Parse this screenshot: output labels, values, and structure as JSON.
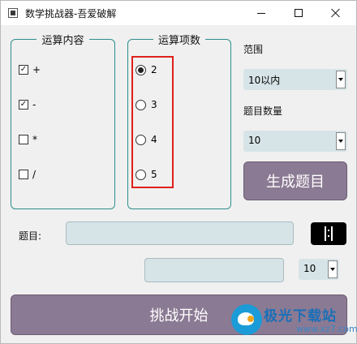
{
  "window": {
    "title": "数学挑战器-吾爱破解"
  },
  "content_group": {
    "title": "运算内容",
    "items": [
      {
        "label": "+",
        "checked": true
      },
      {
        "label": "-",
        "checked": true
      },
      {
        "label": "*",
        "checked": false
      },
      {
        "label": "/",
        "checked": false
      }
    ]
  },
  "operands_group": {
    "title": "运算项数",
    "items": [
      {
        "label": "2",
        "selected": true
      },
      {
        "label": "3",
        "selected": false
      },
      {
        "label": "4",
        "selected": false
      },
      {
        "label": "5",
        "selected": false
      }
    ]
  },
  "range": {
    "label": "范围",
    "value": "10以内"
  },
  "count": {
    "label": "题目数量",
    "value": "10"
  },
  "generate_button": "生成题目",
  "question": {
    "label": "题目:",
    "value": ""
  },
  "answer": {
    "value": ""
  },
  "timer_select": {
    "value": "10"
  },
  "start_button": "挑战开始",
  "watermark": {
    "text": "极光下载站",
    "url": "www.xz7.com"
  },
  "colors": {
    "accent": "#8b7a93",
    "group_border": "#2f8d8d",
    "highlight": "#e0201a",
    "field": "#d7e4e7"
  }
}
